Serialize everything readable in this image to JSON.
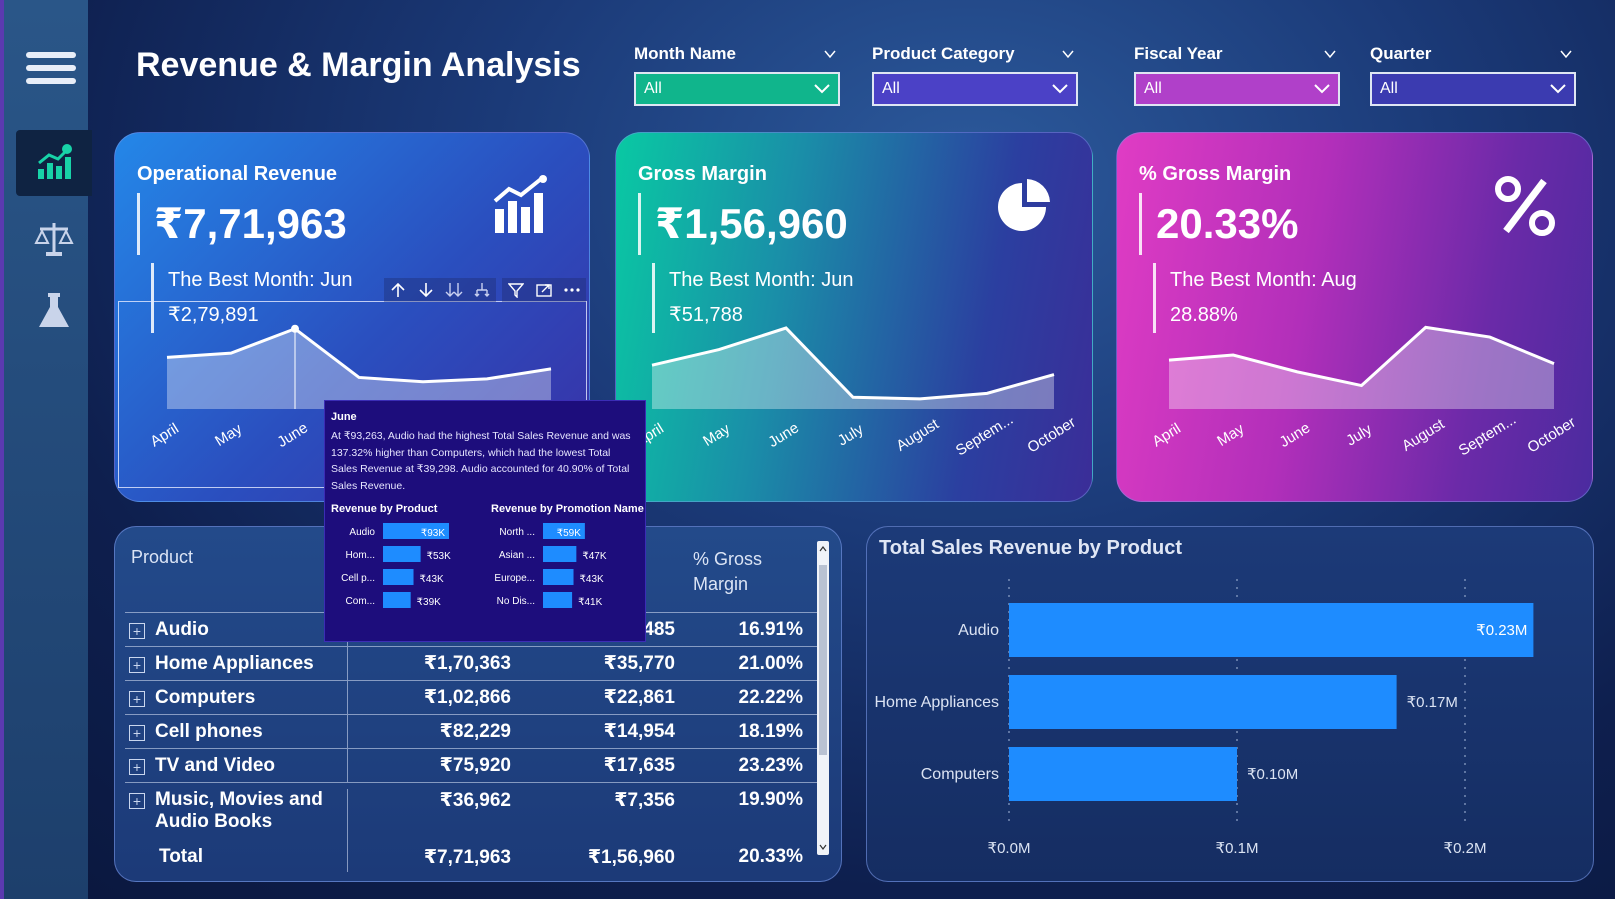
{
  "title": "Revenue & Margin Analysis",
  "nav": {
    "items": [
      "menu-icon",
      "chart-growth-icon",
      "scale-icon",
      "flask-icon"
    ]
  },
  "slicers": [
    {
      "label": "Month Name",
      "value": "All",
      "color": "#10b58c"
    },
    {
      "label": "Product Category",
      "value": "All",
      "color": "#4b41c6"
    },
    {
      "label": "Fiscal Year",
      "value": "All",
      "color": "#b040c9"
    },
    {
      "label": "Quarter",
      "value": "All",
      "color": "#3b3bb0"
    }
  ],
  "kpis": [
    {
      "title": "Operational Revenue",
      "value": "₹7,71,963",
      "best_label": "The Best Month: Jun",
      "best_value": "₹2,79,891"
    },
    {
      "title": "Gross Margin",
      "value": "₹1,56,960",
      "best_label": "The Best Month: Jun",
      "best_value": "₹51,788"
    },
    {
      "title": "% Gross Margin",
      "value": "20.33%",
      "best_label": "The Best Month: Aug",
      "best_value": "28.88%"
    }
  ],
  "months": [
    "April",
    "May",
    "June",
    "July",
    "August",
    "Septem...",
    "October"
  ],
  "sparklines": {
    "card1": [
      180000,
      195000,
      279891,
      110000,
      95000,
      105000,
      140000
    ],
    "card2": [
      28000,
      38000,
      51788,
      7500,
      6500,
      10000,
      22000
    ],
    "card3": [
      20.5,
      21.8,
      17.5,
      14.0,
      28.88,
      26.4,
      19.6
    ]
  },
  "visual_header_icons": [
    "arrow-up-icon",
    "arrow-down-icon",
    "double-arrow-down-icon",
    "hierarchy-icon",
    "filter-icon",
    "focus-mode-icon",
    "more-options-icon"
  ],
  "tooltip": {
    "title": "June",
    "text": "At ₹93,263, Audio had the highest Total Sales Revenue and was 137.32% higher than Computers, which had the lowest Total Sales Revenue at ₹39,298. Audio accounted for 40.90% of Total Sales Revenue.",
    "product_heading": "Revenue by Product",
    "promo_heading": "Revenue by Promotion Name",
    "products": [
      {
        "label": "Audio",
        "value": 93,
        "text": "₹93K"
      },
      {
        "label": "Hom...",
        "value": 53,
        "text": "₹53K"
      },
      {
        "label": "Cell p...",
        "value": 43,
        "text": "₹43K"
      },
      {
        "label": "Com...",
        "value": 39,
        "text": "₹39K"
      }
    ],
    "promos": [
      {
        "label": "North ...",
        "value": 59,
        "text": "₹59K"
      },
      {
        "label": "Asian ...",
        "value": 47,
        "text": "₹47K"
      },
      {
        "label": "Europe...",
        "value": 43,
        "text": "₹43K"
      },
      {
        "label": "No Dis...",
        "value": 41,
        "text": "₹41K"
      }
    ]
  },
  "table": {
    "header_product": "Product",
    "header_gm_pct_1": "% Gross",
    "header_gm_pct_2": "Margin",
    "rows": [
      {
        "product": "Audio",
        "revenue": "",
        "margin": ",485",
        "pct": "16.91%"
      },
      {
        "product": "Home Appliances",
        "revenue": "₹1,70,363",
        "margin": "₹35,770",
        "pct": "21.00%"
      },
      {
        "product": "Computers",
        "revenue": "₹1,02,866",
        "margin": "₹22,861",
        "pct": "22.22%"
      },
      {
        "product": "Cell phones",
        "revenue": "₹82,229",
        "margin": "₹14,954",
        "pct": "18.19%"
      },
      {
        "product": "TV and Video",
        "revenue": "₹75,920",
        "margin": "₹17,635",
        "pct": "23.23%"
      },
      {
        "product": "Music, Movies and Audio Books",
        "revenue": "₹36,962",
        "margin": "₹7,356",
        "pct": "19.90%"
      }
    ],
    "total": {
      "product": "Total",
      "revenue": "₹7,71,963",
      "margin": "₹1,56,960",
      "pct": "20.33%"
    }
  },
  "chart_data": {
    "type": "bar",
    "orientation": "horizontal",
    "title": "Total Sales Revenue by Product",
    "categories": [
      "Audio",
      "Home Appliances",
      "Computers"
    ],
    "values": [
      0.23,
      0.17,
      0.1
    ],
    "value_labels": [
      "₹0.23M",
      "₹0.17M",
      "₹0.10M"
    ],
    "x_ticks": [
      "₹0.0M",
      "₹0.1M",
      "₹0.2M"
    ],
    "xlim": [
      0,
      0.25
    ],
    "color": "#1e8cff",
    "grid": true
  }
}
